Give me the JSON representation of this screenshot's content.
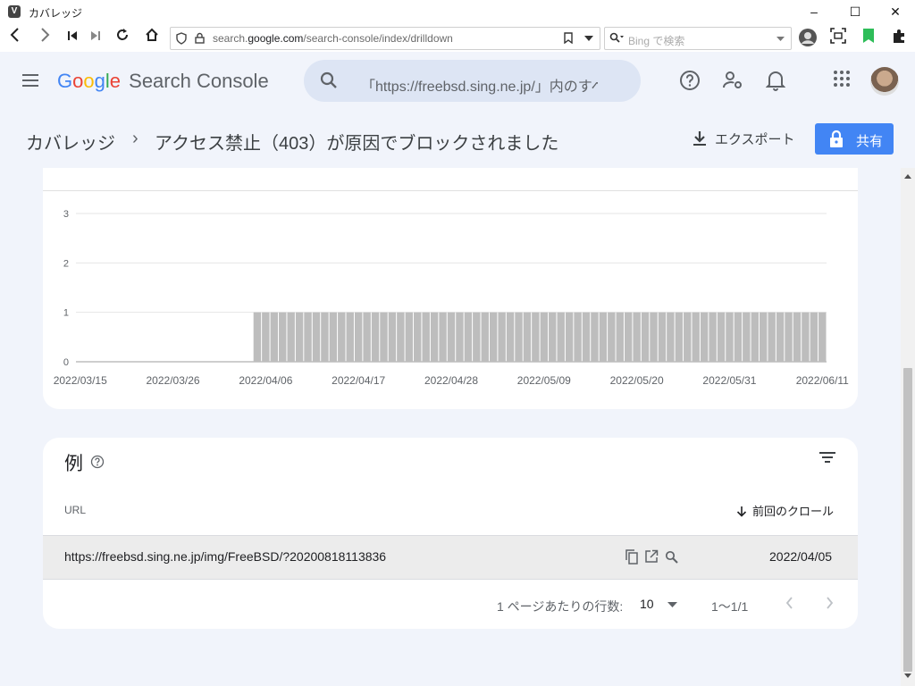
{
  "window": {
    "title": "カバレッジ"
  },
  "browser": {
    "url_prefix": "search.",
    "url_domain": "google.com",
    "url_path": "/search-console/index/drilldown",
    "search_placeholder": "Bing で検索"
  },
  "app": {
    "logo_google": [
      "G",
      "o",
      "o",
      "g",
      "l",
      "e"
    ],
    "logo_product": "Search Console",
    "search_placeholder": "「https://freebsd.sing.ne.jp/」内のすべてのURLを検査",
    "breadcrumb_root": "カバレッジ",
    "breadcrumb_sep": "›",
    "breadcrumb_current": "アクセス禁止（403）が原因でブロックされました",
    "export_label": "エクスポート",
    "share_label": "共有"
  },
  "colors": {
    "google_blue": "#4285F4",
    "google_red": "#EA4335",
    "google_yellow": "#FBBC05",
    "google_green": "#34A853",
    "bar": "#bdbdbd"
  },
  "chart_data": {
    "type": "bar",
    "y_ticks": [
      "3",
      "2",
      "1",
      "0"
    ],
    "ylim": [
      0,
      3
    ],
    "x_tick_labels": [
      "2022/03/15",
      "2022/03/26",
      "2022/04/06",
      "2022/04/17",
      "2022/04/28",
      "2022/05/09",
      "2022/05/20",
      "2022/05/31",
      "2022/06/11"
    ],
    "x_start": "2022/03/15",
    "x_end": "2022/06/11",
    "bar_start": "2022/04/05",
    "bar_value": 1,
    "values_by_day": [
      0,
      0,
      0,
      0,
      0,
      0,
      0,
      0,
      0,
      0,
      0,
      0,
      0,
      0,
      0,
      0,
      0,
      0,
      0,
      0,
      0,
      1,
      1,
      1,
      1,
      1,
      1,
      1,
      1,
      1,
      1,
      1,
      1,
      1,
      1,
      1,
      1,
      1,
      1,
      1,
      1,
      1,
      1,
      1,
      1,
      1,
      1,
      1,
      1,
      1,
      1,
      1,
      1,
      1,
      1,
      1,
      1,
      1,
      1,
      1,
      1,
      1,
      1,
      1,
      1,
      1,
      1,
      1,
      1,
      1,
      1,
      1,
      1,
      1,
      1,
      1,
      1,
      1,
      1,
      1,
      1,
      1,
      1,
      1,
      1,
      1,
      1,
      1,
      1
    ]
  },
  "examples": {
    "title": "例",
    "col_url": "URL",
    "col_crawl": "前回のクロール",
    "rows": [
      {
        "url": "https://freebsd.sing.ne.jp/img/FreeBSD/?20200818113836",
        "date": "2022/04/05"
      }
    ],
    "rows_per_page_label": "1 ページあたりの行数:",
    "rows_per_page": "10",
    "range": "1〜1/1"
  }
}
